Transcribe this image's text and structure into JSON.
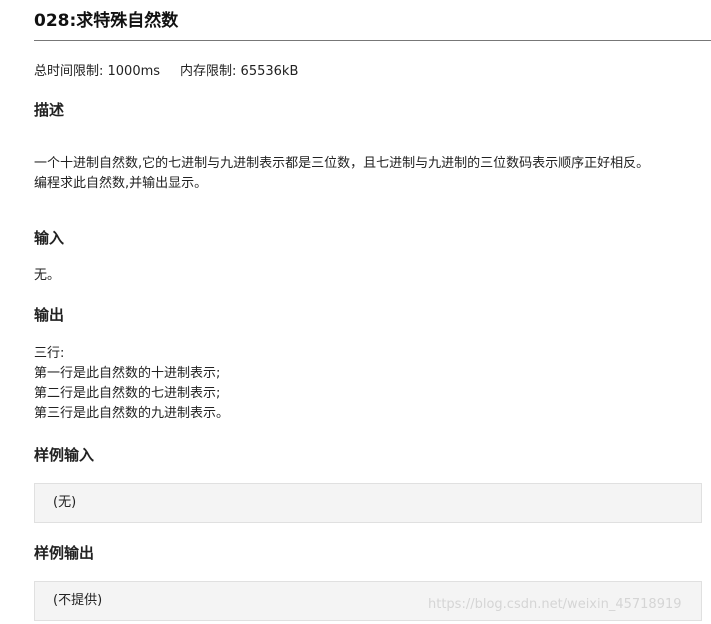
{
  "problem": {
    "title": "028:求特殊自然数",
    "time_limit": "总时间限制: 1000ms",
    "memory_limit": "内存限制: 65536kB"
  },
  "sections": {
    "description": {
      "heading": "描述",
      "lines": [
        "一个十进制自然数,它的七进制与九进制表示都是三位数，且七进制与九进制的三位数码表示顺序正好相反。",
        "编程求此自然数,并输出显示。"
      ]
    },
    "input": {
      "heading": "输入",
      "text": "无。"
    },
    "output": {
      "heading": "输出",
      "lines": [
        "三行:",
        "第一行是此自然数的十进制表示;",
        "第二行是此自然数的七进制表示;",
        "第三行是此自然数的九进制表示。"
      ]
    },
    "sample_input": {
      "heading": "样例输入",
      "content": "(无)"
    },
    "sample_output": {
      "heading": "样例输出",
      "content": "(不提供)"
    }
  },
  "watermark": "https://blog.csdn.net/weixin_45718919"
}
